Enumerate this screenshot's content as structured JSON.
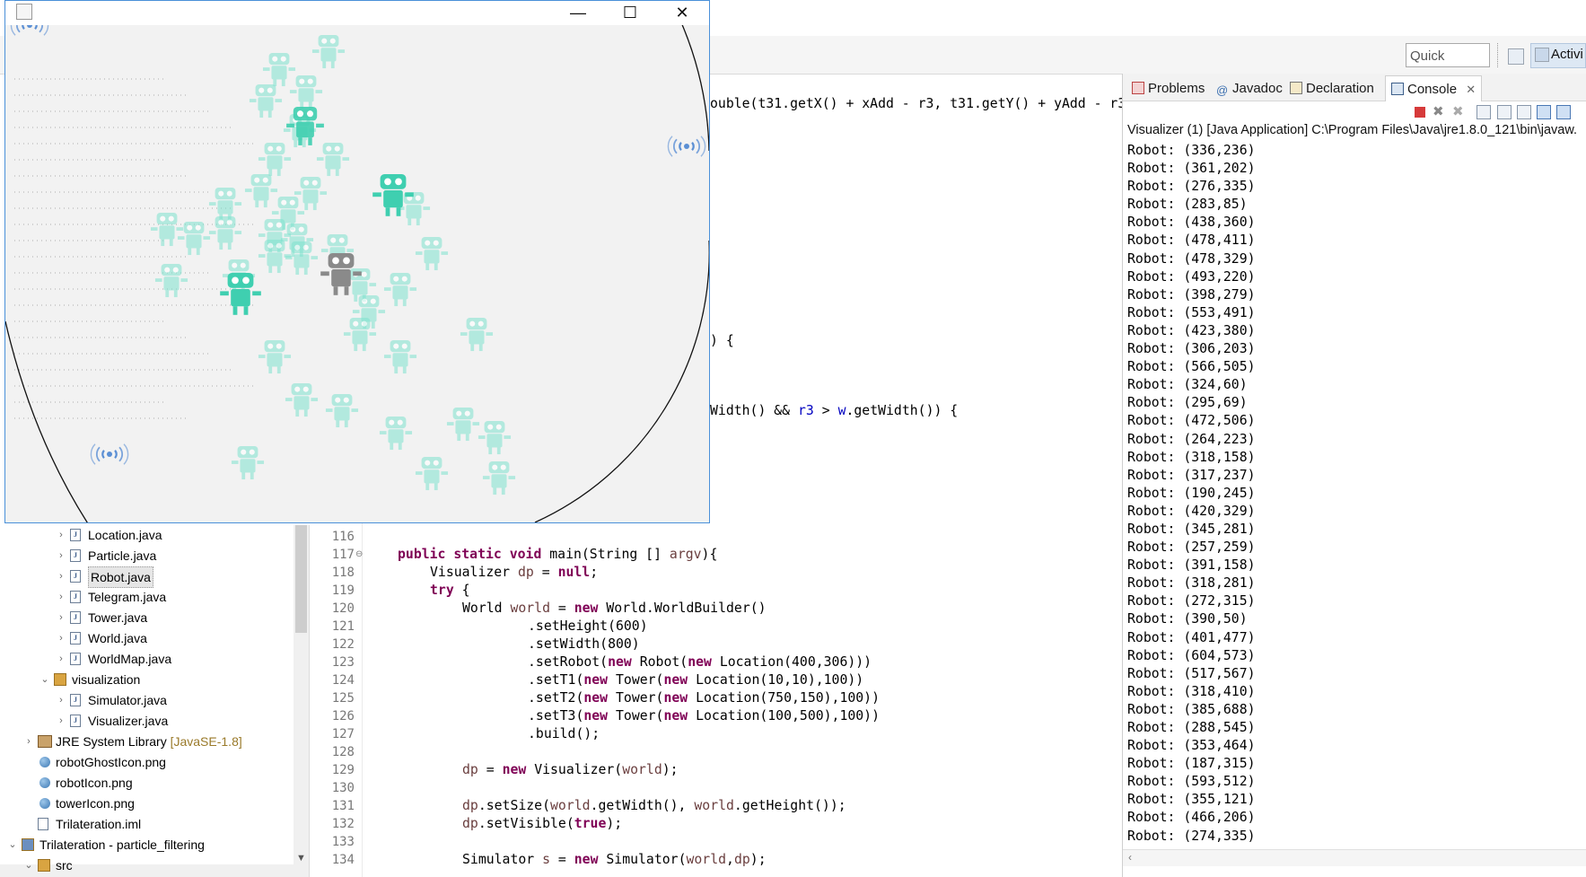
{
  "toolbar": {
    "quick_access": "Quick Access",
    "perspective_label": "Activi"
  },
  "explorer": {
    "items": [
      {
        "label": "Location.java",
        "type": "java",
        "indent": 2
      },
      {
        "label": "Particle.java",
        "type": "java",
        "indent": 2
      },
      {
        "label": "Robot.java",
        "type": "java",
        "indent": 2,
        "selected": true
      },
      {
        "label": "Telegram.java",
        "type": "java",
        "indent": 2
      },
      {
        "label": "Tower.java",
        "type": "java",
        "indent": 2
      },
      {
        "label": "World.java",
        "type": "java",
        "indent": 2
      },
      {
        "label": "WorldMap.java",
        "type": "java",
        "indent": 2
      },
      {
        "label": "visualization",
        "type": "package",
        "indent": 1
      },
      {
        "label": "Simulator.java",
        "type": "java",
        "indent": 2
      },
      {
        "label": "Visualizer.java",
        "type": "java",
        "indent": 2
      },
      {
        "label": "JRE System Library",
        "suffix": "[JavaSE-1.8]",
        "type": "library",
        "indent": 0
      },
      {
        "label": "robotGhostIcon.png",
        "type": "png",
        "indent": 0
      },
      {
        "label": "robotIcon.png",
        "type": "png",
        "indent": 0
      },
      {
        "label": "towerIcon.png",
        "type": "png",
        "indent": 0
      },
      {
        "label": "Trilateration.iml",
        "type": "file",
        "indent": 0
      },
      {
        "label": "Trilateration - particle_filtering",
        "type": "project",
        "indent": -1
      },
      {
        "label": "src",
        "type": "package",
        "indent": 0
      }
    ]
  },
  "editor": {
    "partial_lines": {
      "line_top": "ouble(t31.getX() + xAdd - r3, t31.getY() + yAdd - r3",
      "line_brace": ") {",
      "line_cond_a": "Width() && ",
      "line_cond_b": "r3",
      "line_cond_c": " > ",
      "line_cond_d": "w",
      "line_cond_e": ".getWidth()) {"
    },
    "line_numbers": [
      "116",
      "117",
      "118",
      "119",
      "120",
      "121",
      "122",
      "123",
      "124",
      "125",
      "126",
      "127",
      "128",
      "129",
      "130",
      "131",
      "132",
      "133",
      "134"
    ],
    "code": {
      "l117_kw": "public static void",
      "l117_rest": " main(String [] ",
      "l117_param": "argv",
      "l117_end": "){",
      "l118_a": "Visualizer ",
      "l118_var": "dp",
      "l118_b": " = ",
      "l118_kw": "null",
      "l118_c": ";",
      "l119_kw": "try",
      "l119_rest": " {",
      "l120_a": "World ",
      "l120_var": "world",
      "l120_b": " = ",
      "l120_kw": "new",
      "l120_c": " World.WorldBuilder()",
      "l121": ".setHeight(600)",
      "l122": ".setWidth(800)",
      "l123_a": ".setRobot(",
      "l123_kw1": "new",
      "l123_b": " Robot(",
      "l123_kw2": "new",
      "l123_c": " Location(400,306)))",
      "l124_a": ".setT1(",
      "l124_kw1": "new",
      "l124_b": " Tower(",
      "l124_kw2": "new",
      "l124_c": " Location(10,10),100))",
      "l125_a": ".setT2(",
      "l125_kw1": "new",
      "l125_b": " Tower(",
      "l125_kw2": "new",
      "l125_c": " Location(750,150),100))",
      "l126_a": ".setT3(",
      "l126_kw1": "new",
      "l126_b": " Tower(",
      "l126_kw2": "new",
      "l126_c": " Location(100,500),100))",
      "l127": ".build();",
      "l129_var": "dp",
      "l129_a": " = ",
      "l129_kw": "new",
      "l129_b": " Visualizer(",
      "l129_var2": "world",
      "l129_c": ");",
      "l131_var": "dp",
      "l131_a": ".setSize(",
      "l131_var2": "world",
      "l131_b": ".getWidth(), ",
      "l131_var3": "world",
      "l131_c": ".getHeight());",
      "l132_var": "dp",
      "l132_a": ".setVisible(",
      "l132_kw": "true",
      "l132_b": ");",
      "l134_a": "Simulator ",
      "l134_var": "s",
      "l134_b": " = ",
      "l134_kw": "new",
      "l134_c": " Simulator(",
      "l134_var2": "world",
      "l134_d": ",",
      "l134_var3": "dp",
      "l134_e": ");"
    }
  },
  "console": {
    "tabs": [
      {
        "label": "Problems",
        "icon": "problems-icon"
      },
      {
        "label": "Javadoc",
        "icon": "javadoc-icon"
      },
      {
        "label": "Declaration",
        "icon": "declaration-icon"
      },
      {
        "label": "Console",
        "icon": "console-icon",
        "active": true
      }
    ],
    "description": "Visualizer (1) [Java Application] C:\\Program Files\\Java\\jre1.8.0_121\\bin\\javaw.",
    "lines": [
      "Robot: (336,236)",
      "Robot: (361,202)",
      "Robot: (276,335)",
      "Robot: (283,85)",
      "Robot: (438,360)",
      "Robot: (478,411)",
      "Robot: (478,329)",
      "Robot: (493,220)",
      "Robot: (398,279)",
      "Robot: (553,491)",
      "Robot: (423,380)",
      "Robot: (306,203)",
      "Robot: (566,505)",
      "Robot: (324,60)",
      "Robot: (295,69)",
      "Robot: (472,506)",
      "Robot: (264,223)",
      "Robot: (318,158)",
      "Robot: (317,237)",
      "Robot: (190,245)",
      "Robot: (420,329)",
      "Robot: (345,281)",
      "Robot: (257,259)",
      "Robot: (391,158)",
      "Robot: (318,281)",
      "Robot: (272,315)",
      "Robot: (390,50)",
      "Robot: (401,477)",
      "Robot: (604,573)",
      "Robot: (517,567)",
      "Robot: (318,410)",
      "Robot: (385,688)",
      "Robot: (288,545)",
      "Robot: (353,464)",
      "Robot: (187,315)",
      "Robot: (593,512)",
      "Robot: (355,121)",
      "Robot: (466,206)",
      "Robot: (274,335)"
    ]
  },
  "visualizer": {
    "window_buttons": {
      "minimize": "—",
      "maximize": "☐",
      "close": "✕"
    },
    "colors": {
      "particle": "#7fe3cf",
      "robot": "#3fcfb0",
      "ghost": "#8a8a8a",
      "tower": "#5b8fd4"
    }
  }
}
